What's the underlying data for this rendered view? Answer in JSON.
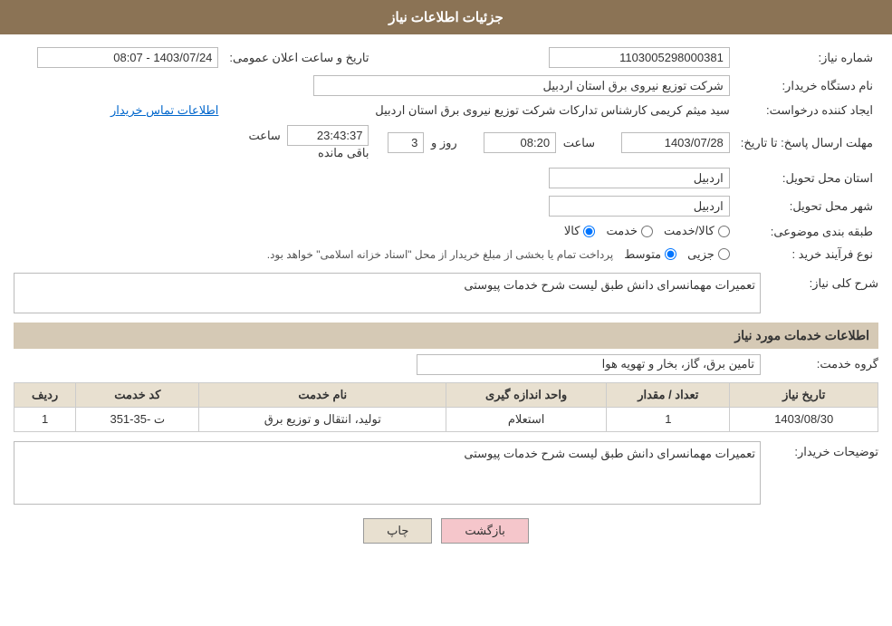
{
  "header": {
    "title": "جزئیات اطلاعات نیاز"
  },
  "fields": {
    "shomareNiaz_label": "شماره نیاز:",
    "shomareNiaz_value": "1103005298000381",
    "namDastgah_label": "نام دستگاه خریدار:",
    "namDastgah_value": "شرکت توزیع نیروی برق استان اردبیل",
    "tarikhAelan_label": "تاریخ و ساعت اعلان عمومی:",
    "tarikhAelan_value": "1403/07/24 - 08:07",
    "ijadKonande_label": "ایجاد کننده درخواست:",
    "ijadKonande_value": "سید میثم کریمی کارشناس تدارکات شرکت توزیع نیروی برق استان اردبیل",
    "ettelaatTamas_label": "اطلاعات تماس خریدار",
    "mohlatErsalPasokh_label": "مهلت ارسال پاسخ: تا تاریخ:",
    "tarikhPasokh": "1403/07/28",
    "saatPasokh": "08:20",
    "roozPasokh": "3",
    "mandeLabel": "ساعت باقی مانده",
    "mandeValue": "23:43:37",
    "ostandMahal_label": "استان محل تحویل:",
    "ostandMahal_value": "اردبیل",
    "shahrMahal_label": "شهر محل تحویل:",
    "shahrMahal_value": "اردبیل",
    "tabaghebandiLabel": "طبقه بندی موضوعی:",
    "tabaghe_kala": "کالا",
    "tabaghe_khadamat": "خدمت",
    "tabaghe_kalaKhadamat": "کالا/خدمت",
    "tabaghe_selected": "kala",
    "noeFarayand_label": "نوع فرآیند خرید :",
    "noeFarayand_jezyi": "جزیی",
    "noeFarayand_motevasset": "متوسط",
    "noeFarayand_desc": "پرداخت تمام یا بخشی از مبلغ خریدار از محل \"اسناد خزانه اسلامی\" خواهد بود.",
    "sharhKolli_label": "شرح کلی نیاز:",
    "sharhKolli_value": "تعمیرات مهمانسرای دانش طبق لیست شرح خدمات پیوستی",
    "serviceInfo_title": "اطلاعات خدمات مورد نیاز",
    "groheKhadamat_label": "گروه خدمت:",
    "groheKhadamat_value": "تامین برق، گاز، بخار و تهویه هوا",
    "table": {
      "col_radif": "ردیف",
      "col_code": "کد خدمت",
      "col_name": "نام خدمت",
      "col_vahed": "واحد اندازه گیری",
      "col_tedaad": "تعداد / مقدار",
      "col_tarikh": "تاریخ نیاز",
      "rows": [
        {
          "radif": "1",
          "code": "ت -35-351",
          "name": "تولید، انتقال و توزیع برق",
          "vahed": "استعلام",
          "tedaad": "1",
          "tarikh": "1403/08/30"
        }
      ]
    },
    "tosifikhatidar_label": "توضیحات خریدار:",
    "tosifikhatidar_value": "تعمیرات مهمانسرای دانش طبق لیست شرح خدمات پیوستی"
  },
  "buttons": {
    "print": "چاپ",
    "back": "بازگشت"
  }
}
